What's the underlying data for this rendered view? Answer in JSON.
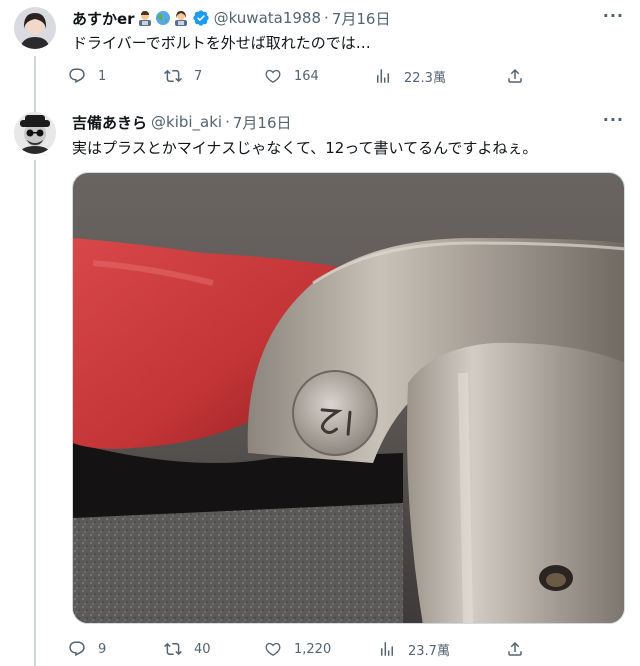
{
  "tweet1": {
    "name": "あすかer",
    "handle": "@kuwata1988",
    "separator": "·",
    "date": "7月16日",
    "text": "ドライバーでボルトを外せば取れたのでは…",
    "emoji": [
      "man-technologist-emoji",
      "globe-emoji",
      "woman-technologist-emoji"
    ],
    "verified": true,
    "stats": {
      "replies": "1",
      "retweets": "7",
      "likes": "164",
      "views": "22.3萬"
    }
  },
  "tweet2": {
    "name": "吉備あきら",
    "handle": "@kibi_aki",
    "separator": "·",
    "date": "7月16日",
    "text": "実はプラスとかマイナスじゃなくて、12って書いてるんですよねぇ。",
    "stats": {
      "replies": "9",
      "retweets": "40",
      "likes": "1,220",
      "views": "23.7萬"
    }
  },
  "more_label": "···",
  "colors": {
    "muted": "#536471",
    "verified": "#1d9bf0",
    "line": "#cfd9de"
  }
}
